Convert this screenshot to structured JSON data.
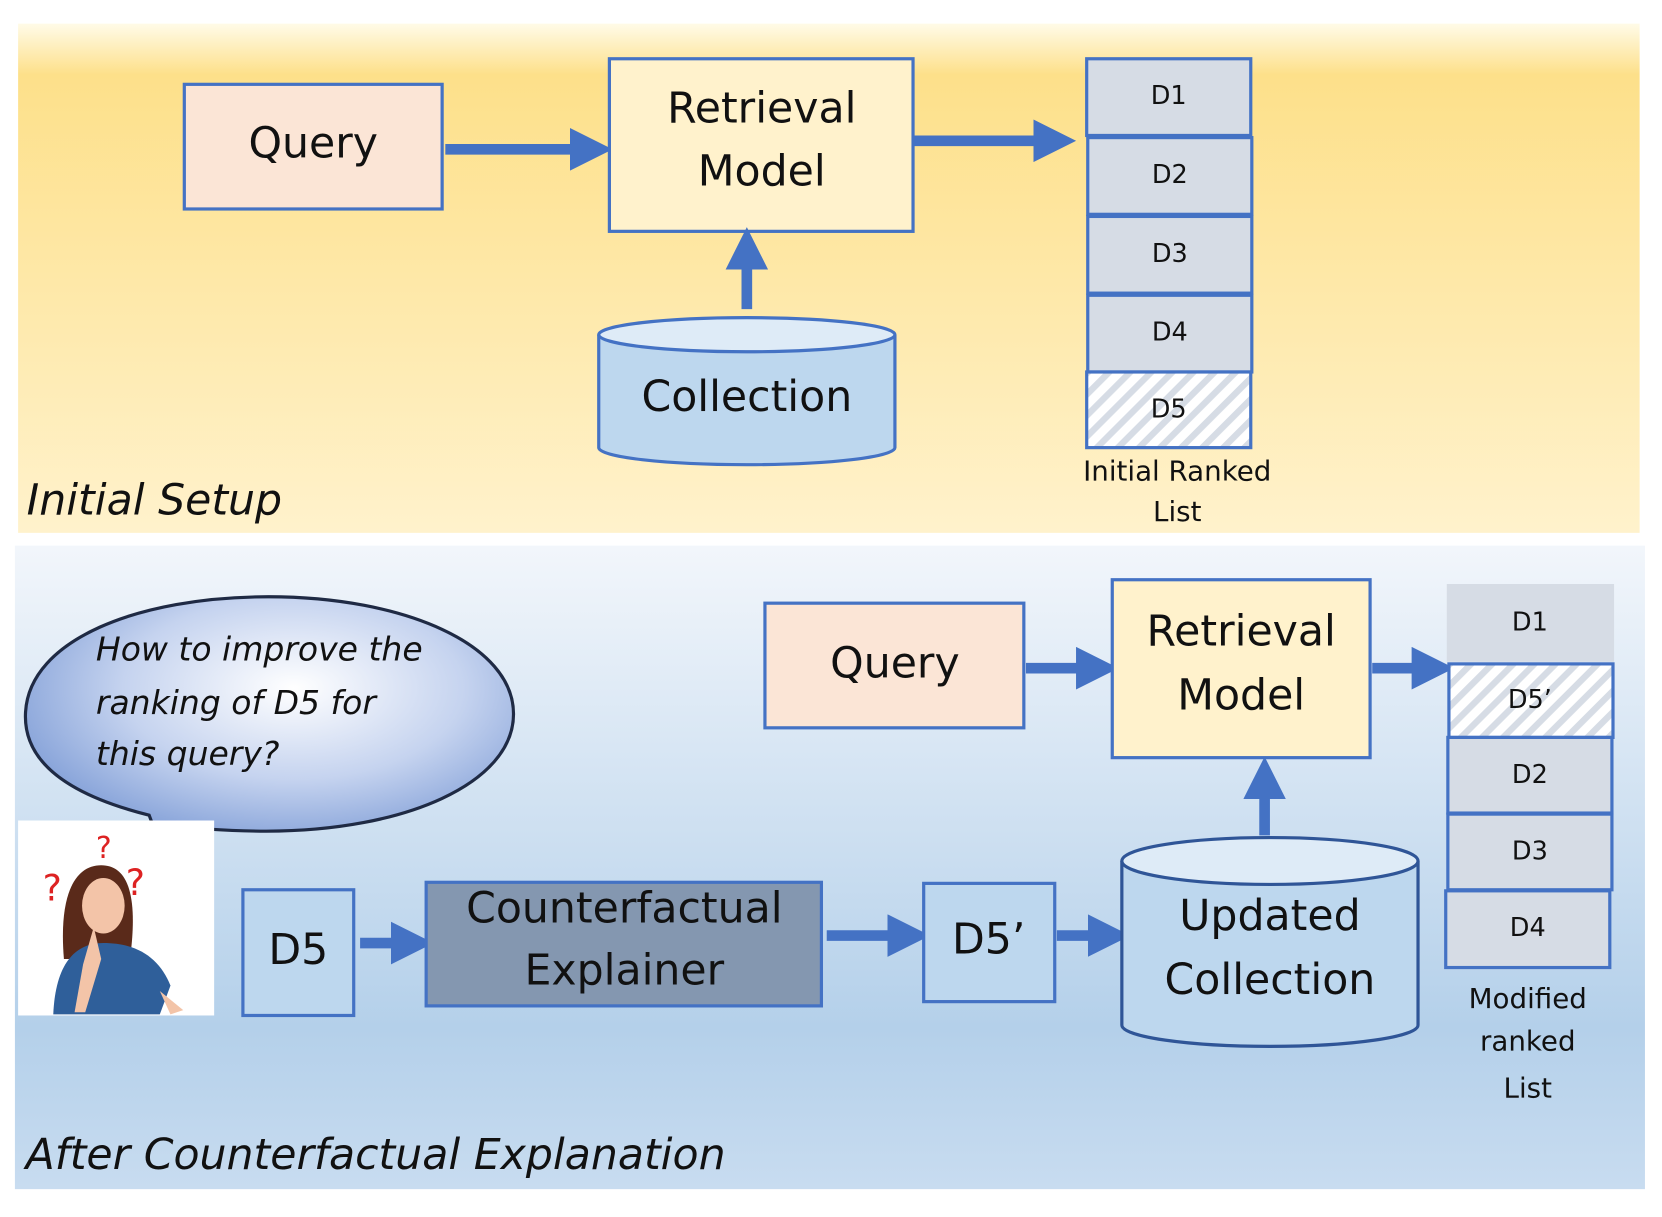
{
  "initial_setup": {
    "section_label": "Initial Setup",
    "query": "Query",
    "retrieval_model": [
      "Retrieval",
      "Model"
    ],
    "collection": "Collection",
    "ranked_list": [
      "D1",
      "D2",
      "D3",
      "D4",
      "D5"
    ],
    "ranked_list_caption": [
      "Initial Ranked",
      "List"
    ]
  },
  "after": {
    "section_label": "After Counterfactual Explanation",
    "speech_bubble": [
      "How to improve the",
      "ranking of D5 for",
      "this  query?"
    ],
    "d5": "D5",
    "explainer": [
      "Counterfactual",
      "Explainer"
    ],
    "d5_prime": "D5’",
    "query": "Query",
    "retrieval_model": [
      "Retrieval",
      "Model"
    ],
    "updated_collection": [
      "Updated",
      "Collection"
    ],
    "ranked_list": [
      "D1",
      "D5’",
      "D2",
      "D3",
      "D4"
    ],
    "ranked_list_caption": [
      "Modified",
      "ranked",
      "List"
    ]
  },
  "colors": {
    "top_bg": "#fde08a",
    "bottom_bg": "#b4d0ea",
    "query_fill": "#fbe5d6",
    "model_fill": "#fff2cc",
    "doc_fill": "#d6dce5",
    "explainer_fill": "#8497b0",
    "border": "#4472c4",
    "arrow": "#4472c4"
  }
}
